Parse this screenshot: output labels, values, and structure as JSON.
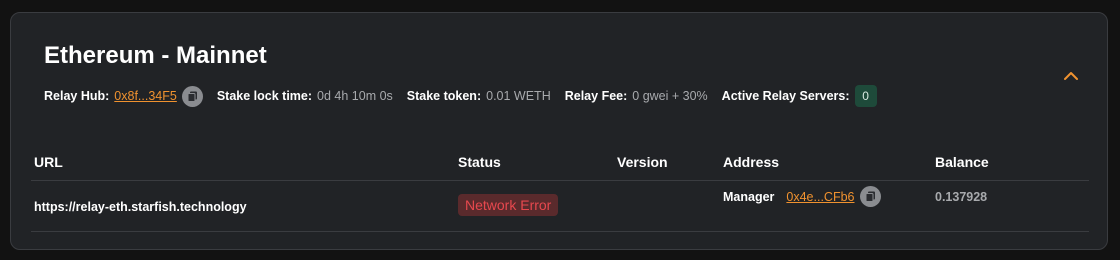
{
  "network": {
    "title": "Ethereum - Mainnet"
  },
  "meta": {
    "relay_hub_label": "Relay Hub:",
    "relay_hub_value": "0x8f...34F5",
    "stake_lock_label": "Stake lock time:",
    "stake_lock_value": "0d 4h 10m 0s",
    "stake_token_label": "Stake token:",
    "stake_token_value": "0.01 WETH",
    "relay_fee_label": "Relay Fee:",
    "relay_fee_value": "0 gwei + 30%",
    "active_servers_label": "Active Relay Servers:",
    "active_servers_value": "0"
  },
  "table": {
    "headers": [
      "URL",
      "Status",
      "Version",
      "Address",
      "Balance"
    ],
    "rows": [
      {
        "url": "https://relay-eth.starfish.technology",
        "status": "Network Error",
        "version": "",
        "address_label": "Manager",
        "address_value": "0x4e...CFb6",
        "balance": "0.137928"
      }
    ]
  },
  "colors": {
    "background": "#121212",
    "card": "#212326",
    "accent_link": "#f0922f",
    "error_text": "#e7484e",
    "error_bg": "#5a2a2c",
    "success_bg": "#1e4a3a"
  },
  "icons": {
    "copy": "copy-icon",
    "collapse": "chevron-up-icon"
  }
}
